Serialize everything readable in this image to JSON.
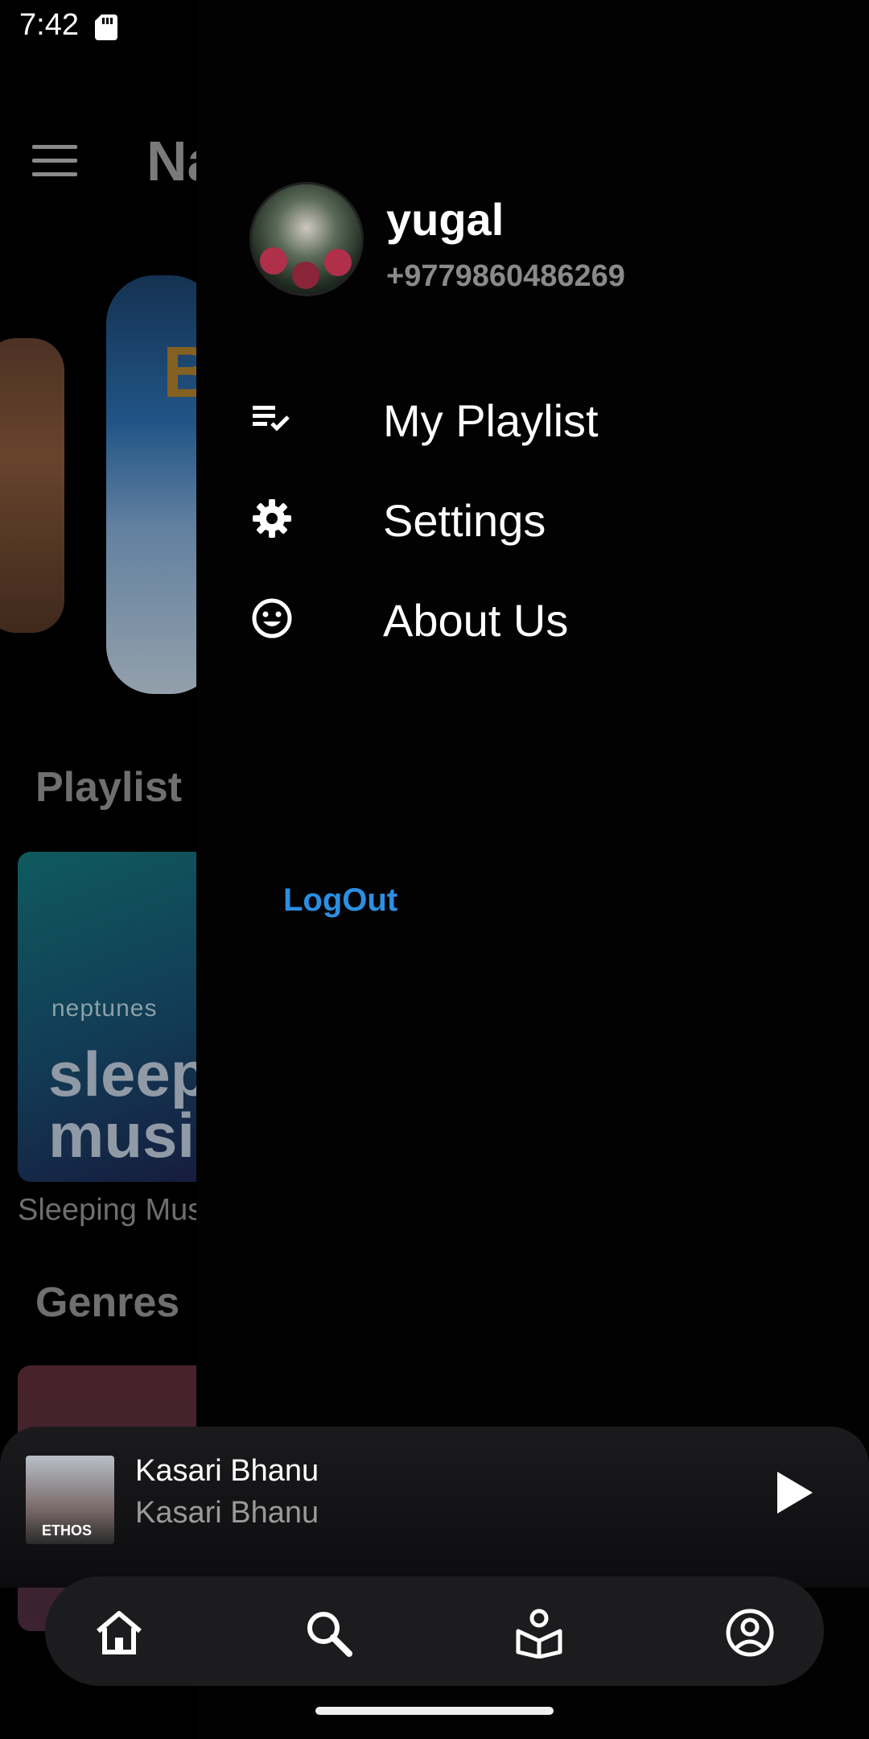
{
  "status_bar": {
    "time": "7:42"
  },
  "background": {
    "app_title": "Na",
    "carousel_text": "BI",
    "section_playlist": "Playlist",
    "playlist_card_brand": "neptunes",
    "playlist_card_text": "sleep music",
    "playlist_card_caption": "Sleeping Mus",
    "section_genres": "Genres"
  },
  "drawer": {
    "user": {
      "name": "yugal",
      "phone": "+9779860486269"
    },
    "menu": [
      {
        "label": "My Playlist",
        "icon": "playlist-check-icon"
      },
      {
        "label": "Settings",
        "icon": "gear-icon"
      },
      {
        "label": "About Us",
        "icon": "smiley-icon"
      }
    ],
    "logout_label": "LogOut"
  },
  "mini_player": {
    "title": "Kasari Bhanu",
    "artist": "Kasari Bhanu",
    "album_art_text": "ETHOS"
  },
  "bottom_nav": [
    {
      "icon": "home-icon"
    },
    {
      "icon": "search-icon"
    },
    {
      "icon": "library-icon"
    },
    {
      "icon": "account-icon"
    }
  ],
  "colors": {
    "accent": "#2b8fe3",
    "drawer_bg": "#020203",
    "nav_bg": "#1c1c1e"
  }
}
